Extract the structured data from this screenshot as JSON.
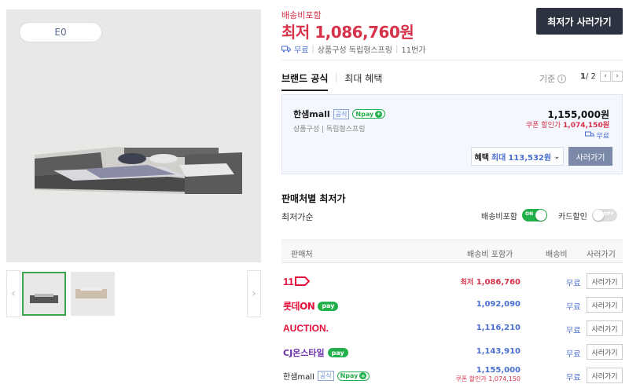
{
  "gallery": {
    "badge": "E0",
    "prev_icon": "‹",
    "next_icon": "›"
  },
  "summary": {
    "shipping_included": "배송비포함",
    "lowest_price": "최저 1,086,760원",
    "buy_button": "최저가 사러가기",
    "delivery_free": "무료",
    "product_config": "상품구성 독립형스프링",
    "mall_count": "11번가"
  },
  "tabs": [
    {
      "label": "브랜드 공식",
      "active": true
    },
    {
      "label": "최대 혜택",
      "active": false
    }
  ],
  "tab_meta": {
    "criteria": "기준",
    "info": "i",
    "page_current": "1",
    "page_total": "/ 2",
    "prev": "‹",
    "next": "›"
  },
  "offer": {
    "mall": "한샘mall",
    "official": "공식",
    "npay": "pay",
    "npay_prefix": "N",
    "npay_plus": "+",
    "spec": "상품구성 | 독립형스프링",
    "price": "1,155,000원",
    "coupon_label": "쿠폰 할인가",
    "coupon_price": "1,074,150원",
    "shipping": "무료",
    "benefit_label": "혜택",
    "benefit_prefix": "최대",
    "benefit_value": "113,532원",
    "benefit_chevron": "⌄",
    "buy": "사러가기"
  },
  "sellers_section": {
    "title": "판매처별 최저가",
    "sort": "최저가순",
    "toggle_shipping_label": "배송비포함",
    "toggle_shipping_state": "ON",
    "toggle_card_label": "카드할인",
    "toggle_card_state": "OFF"
  },
  "table": {
    "headers": {
      "seller": "판매처",
      "price": "배송비 포함가",
      "shipping": "배송비",
      "buy": "사러가기"
    },
    "rows": [
      {
        "seller": "11번가",
        "price_prefix": "최저",
        "price": "1,086,760",
        "shipping": "무료",
        "buy": "사러가기"
      },
      {
        "seller": "롯데ON",
        "npay": "pay",
        "price": "1,092,090",
        "shipping": "무료",
        "buy": "사러가기"
      },
      {
        "seller": "AUCTION.",
        "price": "1,116,210",
        "shipping": "무료",
        "buy": "사러가기"
      },
      {
        "seller": "CJ온스타일",
        "npay": "pay",
        "price": "1,143,910",
        "shipping": "무료",
        "buy": "사러가기"
      },
      {
        "seller": "한샘mall",
        "official": "공식",
        "npay": "pay",
        "price": "1,155,000",
        "coupon_label": "쿠폰 할인가",
        "coupon_price": "1,074,150",
        "shipping": "무료",
        "buy": "사러가기"
      }
    ]
  },
  "colors": {
    "accent_red": "#d6324a",
    "accent_blue": "#4a6fd0",
    "npay_green": "#22b04b",
    "dark_button": "#2d3240"
  }
}
